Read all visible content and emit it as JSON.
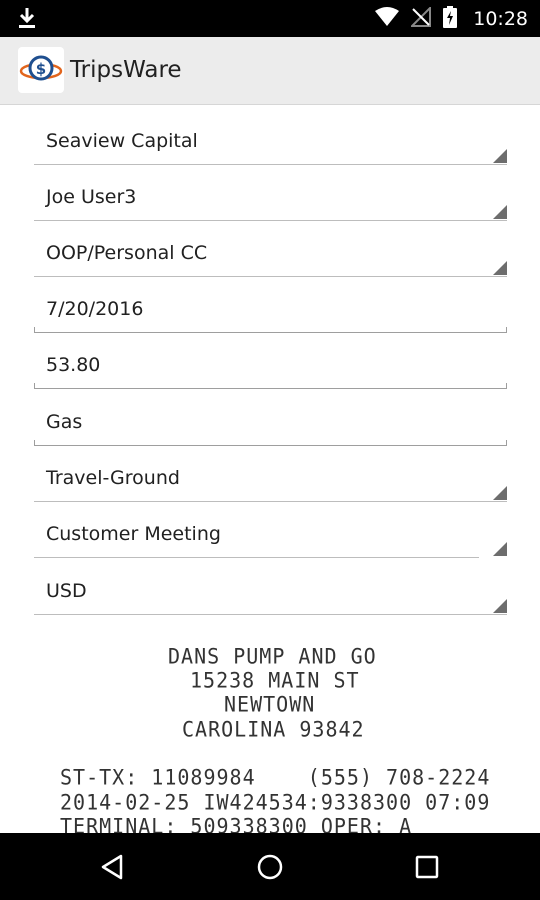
{
  "status_bar": {
    "time": "10:28",
    "icons": [
      "download-icon",
      "wifi-icon",
      "no-signal-icon",
      "battery-icon"
    ]
  },
  "app_bar": {
    "title": "TripsWare",
    "logo_icon": "dollar-globe-icon"
  },
  "form": {
    "company": "Seaview Capital",
    "employee": "Joe User3",
    "payment_method": "OOP/Personal CC",
    "date": "7/20/2016",
    "amount": "53.80",
    "description": "Gas",
    "category": "Travel-Ground",
    "purpose": "Customer Meeting",
    "currency": "USD"
  },
  "receipt": {
    "line1": "DANS PUMP AND GO",
    "line2": "15238 MAIN ST",
    "line3": "NEWTOWN",
    "line4": "CAROLINA 93842",
    "line5": "ST-TX: 11089984    (555) 708-2224",
    "line6": "2014-02-25 IW424534:9338300 07:09",
    "line7": "TERMINAL: 509338300 OPER: A"
  },
  "nav_bar": {
    "icons": [
      "back-icon",
      "home-icon",
      "recents-icon"
    ]
  },
  "colors": {
    "status_bar": "#000000",
    "action_bar": "#ececec",
    "divider": "#bdbdbd",
    "spinner_arrow": "#6d6d6d",
    "text": "#212121"
  }
}
